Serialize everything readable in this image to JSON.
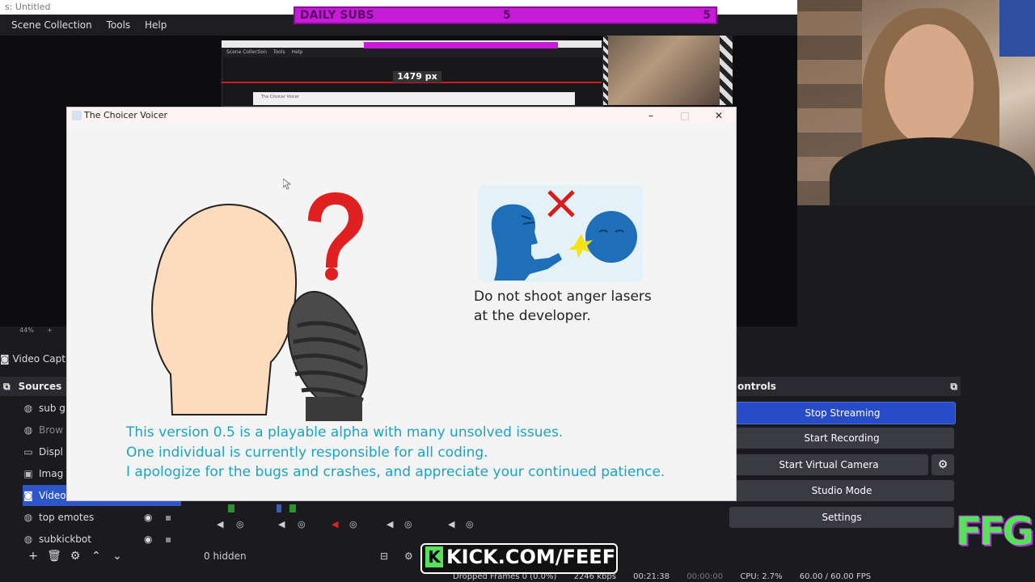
{
  "obs": {
    "window_title": "s: Untitled",
    "menu": [
      "Scene Collection",
      "Tools",
      "Help"
    ],
    "preview": {
      "daily_subs_label": "DAILY SUBS",
      "daily_subs_mid": "5",
      "daily_subs_right": "5",
      "nested_menu": [
        "Scene Collection",
        "Tools",
        "Help"
      ],
      "nested_window_title": "The Choicer Voicer",
      "px_badge": "1479 px"
    },
    "zoom": "44%",
    "video_capture_label": "Video Capt",
    "sources": {
      "header": "Sources",
      "items": [
        {
          "label": "sub g",
          "icon": "globe-icon"
        },
        {
          "label": "Brow",
          "icon": "globe-icon"
        },
        {
          "label": "Displ",
          "icon": "monitor-icon"
        },
        {
          "label": "Imag",
          "icon": "image-icon"
        },
        {
          "label": "Video",
          "icon": "camera-icon"
        },
        {
          "label": "top emotes",
          "icon": "globe-icon"
        },
        {
          "label": "subkickbot",
          "icon": "globe-icon"
        }
      ]
    },
    "mixer_footer": "0 hidden",
    "controls": {
      "header": "ontrols",
      "stop_streaming": "Stop Streaming",
      "start_recording": "Start Recording",
      "start_virtual_camera": "Start Virtual Camera",
      "studio_mode": "Studio Mode",
      "settings": "Settings"
    },
    "status": {
      "dropped_frames": "Dropped Frames 0 (0.0%)",
      "bitrate": "2246 kbps",
      "stream_time": "00:21:38",
      "rec_time": "00:00:00",
      "cpu": "CPU: 2.7%",
      "fps": "60.00 / 60.00 FPS"
    }
  },
  "overlay": {
    "ffg_logo": "FFG",
    "kick_k": "K",
    "kick_url": "KICK.COM/FEEF"
  },
  "dialog": {
    "title": "The Choicer Voicer",
    "minimize": "–",
    "maximize": "□",
    "close": "✕",
    "warning_caption_line1": "Do not shoot anger lasers",
    "warning_caption_line2": "at the developer.",
    "notice_line1": "This version 0.5 is a playable alpha with many unsolved issues.",
    "notice_line2": "One individual is currently responsible for all coding.",
    "notice_line3": "I apologize for the bugs and crashes, and appreciate your continued patience."
  },
  "colors": {
    "accent_blue": "#284cc8",
    "notice_text": "#1aa3c4",
    "daily_subs_bar": "#c61cd8",
    "question_mark": "#e02020"
  }
}
